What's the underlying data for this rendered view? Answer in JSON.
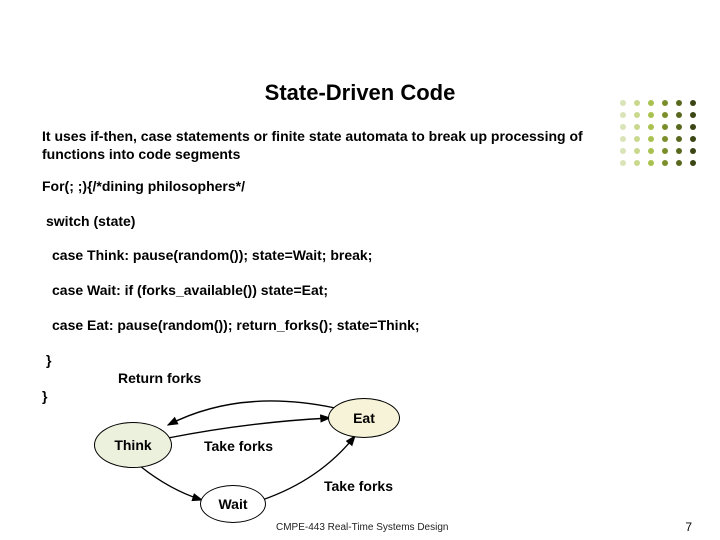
{
  "title": "State-Driven Code",
  "intro": "It uses if-then, case statements or finite state automata to break up processing of functions into code segments",
  "code": {
    "for_line": "For(; ;){/*dining philosophers*/",
    "switch_line": "switch (state)",
    "case_think": "case Think: pause(random()); state=Wait; break;",
    "case_wait": "case Wait: if (forks_available()) state=Eat;",
    "case_eat": "case Eat: pause(random()); return_forks(); state=Think;",
    "brace1": "}",
    "brace2": "}",
    "return_forks_label": "Return forks"
  },
  "diagram": {
    "nodes": {
      "think": "Think",
      "eat": "Eat",
      "wait": "Wait"
    },
    "edges": {
      "take_forks_1": "Take forks",
      "take_forks_2": "Take forks"
    }
  },
  "footer": "CMPE-443 Real-Time Systems Design",
  "page_number": "7"
}
